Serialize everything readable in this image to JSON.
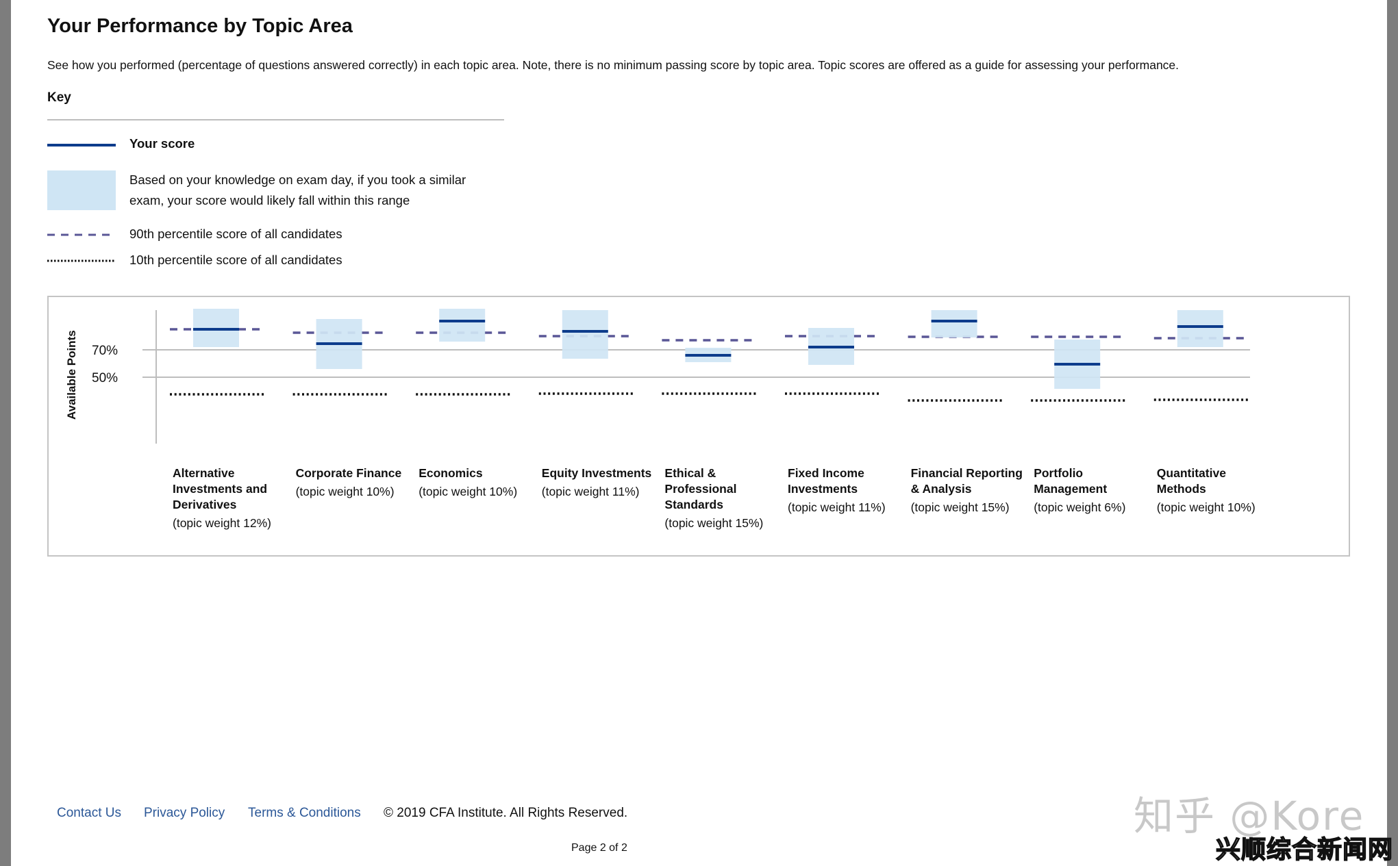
{
  "page": {
    "title": "Your Performance by Topic Area",
    "description": "See how you performed (percentage of questions answered correctly) in each topic area. Note, there is no minimum passing score by topic area. Topic scores are offered as a guide for assessing your performance."
  },
  "key": {
    "title": "Key",
    "items": [
      {
        "icon": "solid-line-icon",
        "label": "Your score"
      },
      {
        "icon": "range-swatch-icon",
        "label_line1": "Based on your knowledge on exam day, if you took a similar",
        "label_line2": "exam, your score would likely fall within this range"
      },
      {
        "icon": "dashed-line-icon",
        "label": "90th percentile score of all candidates"
      },
      {
        "icon": "dotted-line-icon",
        "label": "10th percentile score of all candidates"
      }
    ]
  },
  "colors": {
    "score_line": "#0d3c8c",
    "range_fill": "#cfe5f4",
    "p90_line": "#5a5796",
    "p10_line": "#111111",
    "gridline": "#bdbdbd",
    "link": "#2b5797"
  },
  "chart_data": {
    "type": "range-box",
    "title": "Your Performance by Topic Area",
    "ylabel": "Available Points",
    "xlabel": "",
    "ylim": [
      0,
      100
    ],
    "y_ticks": [
      {
        "value": 70,
        "label": "70%"
      },
      {
        "value": 50,
        "label": "50%"
      }
    ],
    "grid": true,
    "legend": "top-left (key section above chart)",
    "categories": [
      {
        "name": "Alternative Investments and Derivatives",
        "name_lines": [
          "Alternative",
          "Investments and",
          "Derivatives"
        ],
        "weight": "(topic weight 12%)",
        "range_low": 72,
        "range_high": 100,
        "score": 85,
        "p90": 85,
        "p10": 37.5
      },
      {
        "name": "Corporate Finance",
        "name_lines": [
          "Corporate Finance"
        ],
        "weight": "(topic weight 10%)",
        "range_low": 56,
        "range_high": 92.5,
        "score": 74.5,
        "p90": 82.5,
        "p10": 37.5
      },
      {
        "name": "Economics",
        "name_lines": [
          "Economics"
        ],
        "weight": "(topic weight 10%)",
        "range_low": 76,
        "range_high": 100,
        "score": 91,
        "p90": 82.5,
        "p10": 37.5
      },
      {
        "name": "Equity Investments",
        "name_lines": [
          "Equity Investments"
        ],
        "weight": "(topic weight 11%)",
        "range_low": 63.5,
        "range_high": 99,
        "score": 83.5,
        "p90": 80,
        "p10": 38
      },
      {
        "name": "Ethical & Professional Standards",
        "name_lines": [
          "Ethical &",
          "Professional",
          "Standards"
        ],
        "weight": "(topic weight 15%)",
        "range_low": 61,
        "range_high": 71.5,
        "score": 66,
        "p90": 77,
        "p10": 38
      },
      {
        "name": "Fixed Income Investments",
        "name_lines": [
          "Fixed Income",
          "Investments"
        ],
        "weight": "(topic weight 11%)",
        "range_low": 59,
        "range_high": 86,
        "score": 72,
        "p90": 80,
        "p10": 38
      },
      {
        "name": "Financial Reporting & Analysis",
        "name_lines": [
          "Financial Reporting",
          "& Analysis"
        ],
        "weight": "(topic weight 15%)",
        "range_low": 79,
        "range_high": 99,
        "score": 91,
        "p90": 79.5,
        "p10": 33
      },
      {
        "name": "Portfolio Management",
        "name_lines": [
          "Portfolio",
          "Management"
        ],
        "weight": "(topic weight 6%)",
        "range_low": 41.5,
        "range_high": 77.5,
        "score": 59.5,
        "p90": 79.5,
        "p10": 33
      },
      {
        "name": "Quantitative Methods",
        "name_lines": [
          "Quantitative",
          "Methods"
        ],
        "weight": "(topic weight 10%)",
        "range_low": 72,
        "range_high": 99,
        "score": 87,
        "p90": 78.5,
        "p10": 33.5
      }
    ]
  },
  "footer": {
    "links": [
      "Contact Us",
      "Privacy Policy",
      "Terms & Conditions"
    ],
    "copyright": "© 2019 CFA Institute. All Rights Reserved.",
    "page_indicator": "Page 2 of 2"
  },
  "watermark": {
    "line1": "知乎 @Kore",
    "line2": "兴顺综合新闻网"
  }
}
